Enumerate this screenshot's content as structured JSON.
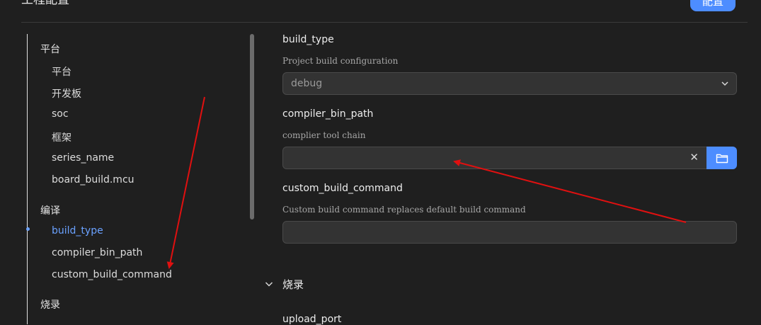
{
  "header": {
    "title": "工程配置",
    "action_label": "配置"
  },
  "nav": {
    "groups": [
      {
        "label": "平台",
        "items": [
          "平台",
          "开发板",
          "soc",
          "框架",
          "series_name",
          "board_build.mcu"
        ]
      },
      {
        "label": "编译",
        "items": [
          "build_type",
          "compiler_bin_path",
          "custom_build_command"
        ]
      },
      {
        "label": "烧录",
        "items": []
      }
    ],
    "active_item": "build_type"
  },
  "form": {
    "fields": [
      {
        "title": "build_type",
        "description": "Project build configuration",
        "value": "debug"
      },
      {
        "title": "compiler_bin_path",
        "description": "complier tool chain",
        "value": ""
      },
      {
        "title": "custom_build_command",
        "description": "Custom build command replaces default build command",
        "value": ""
      }
    ],
    "next_section": "烧录",
    "next_field_title": "upload_port"
  },
  "colors": {
    "accent": "#4d8dff",
    "active_nav": "#6aa1ff",
    "annotation_arrow": "#e01010",
    "background": "#1f1f1f"
  },
  "icons": {
    "select": "chevron-down-icon",
    "clear": "close-icon",
    "browse": "folder-icon",
    "section": "chevron-down-icon"
  }
}
